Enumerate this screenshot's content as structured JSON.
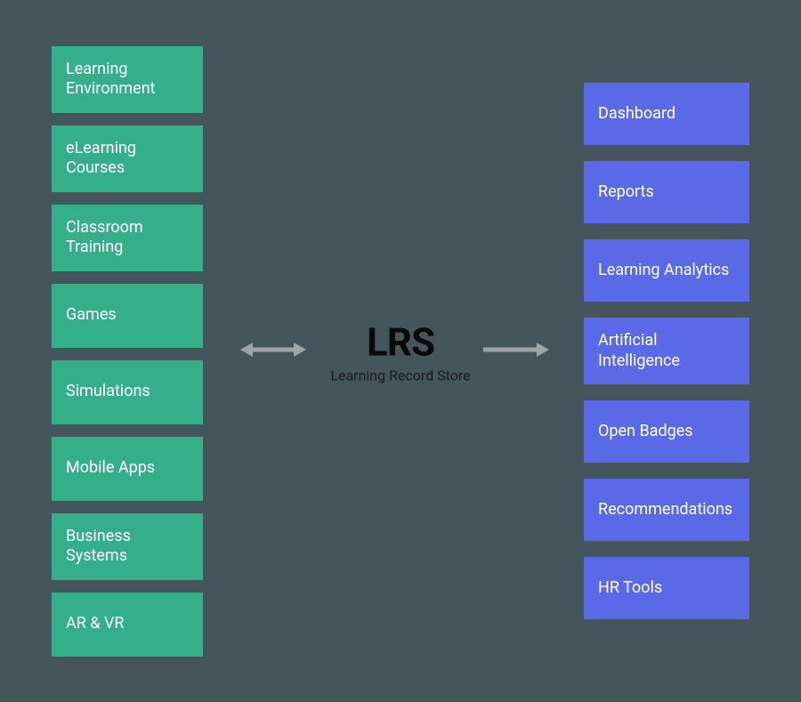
{
  "center": {
    "title": "LRS",
    "subtitle": "Learning Record Store"
  },
  "leftColumn": {
    "items": [
      {
        "label": "Learning Environment"
      },
      {
        "label": "eLearning Courses"
      },
      {
        "label": "Classroom Training"
      },
      {
        "label": "Games"
      },
      {
        "label": "Simulations"
      },
      {
        "label": "Mobile Apps"
      },
      {
        "label": "Business Systems"
      },
      {
        "label": "AR & VR"
      }
    ]
  },
  "rightColumn": {
    "items": [
      {
        "label": "Dashboard"
      },
      {
        "label": "Reports"
      },
      {
        "label": "Learning Analytics"
      },
      {
        "label": "Artificial Intelligence"
      },
      {
        "label": "Open Badges"
      },
      {
        "label": "Recommendations"
      },
      {
        "label": "HR Tools"
      }
    ]
  },
  "colors": {
    "background": "#44565c",
    "leftBox": "#35af8a",
    "rightBox": "#5a69e6",
    "arrow": "#9da5a8"
  }
}
